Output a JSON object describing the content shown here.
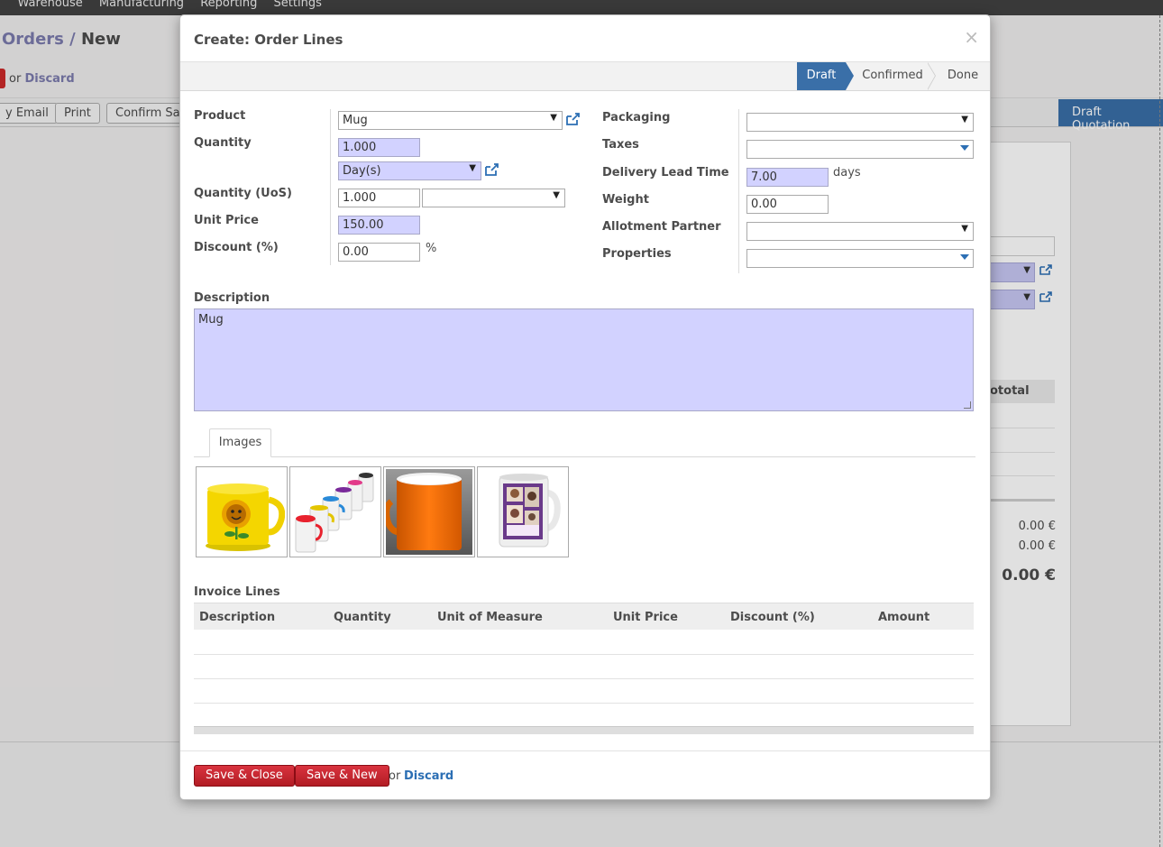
{
  "background": {
    "menu": [
      "Warehouse",
      "Manufacturing",
      "Reporting",
      "Settings"
    ],
    "breadcrumb_parent": "Orders",
    "breadcrumb_sep": " / ",
    "breadcrumb_current": "New",
    "or_text": "or",
    "discard_label": "Discard",
    "buttons": [
      "y Email",
      "Print",
      "Confirm Sale"
    ],
    "status_label": "Draft Quotation",
    "subtotal_header": "ototal",
    "amounts": [
      "0.00 €",
      "0.00 €"
    ],
    "total": "0.00 €"
  },
  "dialog": {
    "title": "Create: Order Lines",
    "close_symbol": "×",
    "stages": [
      "Draft",
      "Confirmed",
      "Done"
    ],
    "active_stage": "Draft",
    "left_fields": {
      "product": {
        "label": "Product",
        "value": "Mug"
      },
      "quantity": {
        "label": "Quantity",
        "value": "1.000",
        "uom": "Day(s)"
      },
      "quantity_uos": {
        "label": "Quantity (UoS)",
        "value": "1.000",
        "uos": ""
      },
      "unit_price": {
        "label": "Unit Price",
        "value": "150.00"
      },
      "discount": {
        "label": "Discount (%)",
        "value": "0.00",
        "suffix": "%"
      }
    },
    "right_fields": {
      "packaging": {
        "label": "Packaging",
        "value": ""
      },
      "taxes": {
        "label": "Taxes",
        "value": ""
      },
      "delay": {
        "label": "Delivery Lead Time",
        "value": "7.00",
        "suffix": "days"
      },
      "weight": {
        "label": "Weight",
        "value": "0.00"
      },
      "allotment": {
        "label": "Allotment Partner",
        "value": ""
      },
      "properties": {
        "label": "Properties",
        "value": ""
      }
    },
    "description": {
      "label": "Description",
      "value": "Mug"
    },
    "tabs": [
      "Images"
    ],
    "images": [
      "yellow-sunflower-mug",
      "colorful-mugs",
      "orange-mug",
      "photo-mug"
    ],
    "invoice_lines": {
      "label": "Invoice Lines",
      "columns": [
        "Description",
        "Quantity",
        "Unit of Measure",
        "Unit Price",
        "Discount (%)",
        "Amount"
      ],
      "rows": []
    },
    "footer": {
      "save_close": "Save & Close",
      "save_new": "Save & New",
      "or_text": "or",
      "discard": "Discard"
    }
  },
  "colors": {
    "required_field": "#d2d2ff",
    "status_active": "#3a6fa8",
    "button_red": "#c0272f",
    "link": "#2c6fb4"
  }
}
